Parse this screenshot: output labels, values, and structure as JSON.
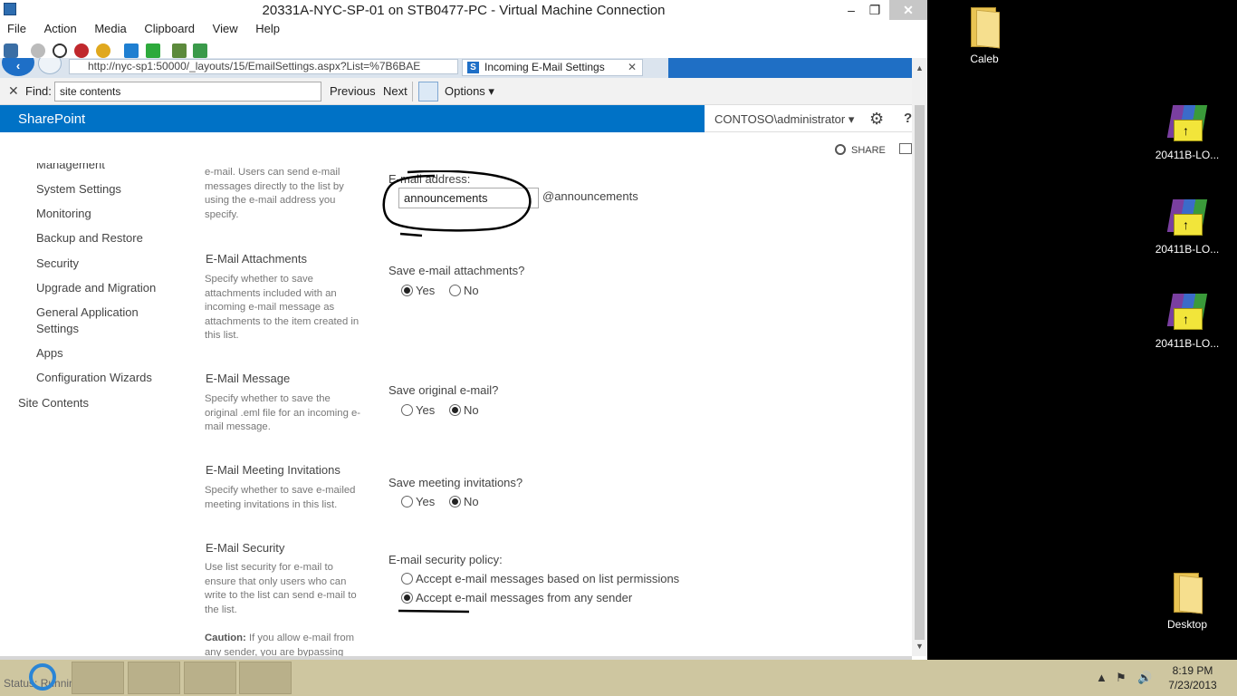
{
  "vm": {
    "title": "20331A-NYC-SP-01 on STB0477-PC - Virtual Machine Connection",
    "minimize": "–",
    "maximize": "❐",
    "close": "✕",
    "menu": [
      "File",
      "Action",
      "Media",
      "Clipboard",
      "View",
      "Help"
    ]
  },
  "browser": {
    "address": "http://nyc-sp1:50000/_layouts/15/EmailSettings.aspx?List=%7B6BAE",
    "tab_title": "Incoming E-Mail Settings",
    "tab_close": "✕"
  },
  "findbar": {
    "close": "✕",
    "label": "Find:",
    "value": "site contents",
    "previous": "Previous",
    "next": "Next",
    "options": "Options ▾"
  },
  "suitebar": {
    "brand": "SharePoint",
    "user": "CONTOSO\\administrator ▾",
    "gear": "⚙",
    "help": "?"
  },
  "sharebar": {
    "share": "SHARE"
  },
  "nav": {
    "items": [
      "Management",
      "System Settings",
      "Monitoring",
      "Backup and Restore",
      "Security",
      "Upgrade and Migration",
      "General Application",
      "Settings",
      "Apps",
      "Configuration Wizards"
    ],
    "site_contents": "Site Contents"
  },
  "sections": {
    "address_desc": "e-mail. Users can send e-mail messages directly to the list by using the e-mail address you specify.",
    "email_label": "E-mail address:",
    "email_value": "announcements",
    "email_suffix": "@announcements",
    "attachments": {
      "title": "E-Mail Attachments",
      "desc": "Specify whether to save attachments included with an incoming e-mail message as attachments to the item created in this list.",
      "question": "Save e-mail attachments?",
      "yes": "Yes",
      "no": "No",
      "selected": "Yes"
    },
    "message": {
      "title": "E-Mail Message",
      "desc": "Specify whether to save the original .eml file for an incoming e-mail message.",
      "question": "Save original e-mail?",
      "yes": "Yes",
      "no": "No",
      "selected": "No"
    },
    "meetings": {
      "title": "E-Mail Meeting Invitations",
      "desc": "Specify whether to save e-mailed meeting invitations in this list.",
      "question": "Save meeting invitations?",
      "yes": "Yes",
      "no": "No",
      "selected": "No"
    },
    "security": {
      "title": "E-Mail Security",
      "desc": "Use list security for e-mail to ensure that only users who can write to the list can send e-mail to the list.",
      "caution_label": "Caution:",
      "caution_text": "If you allow e-mail from any sender, you are bypassing",
      "question": "E-mail security policy:",
      "option1": "Accept e-mail messages based on list permissions",
      "option2": "Accept e-mail messages from any sender",
      "selected": "option2"
    }
  },
  "desktop": {
    "icons": [
      "Caleb",
      "20411B-LO...",
      "20411B-LO...",
      "20411B-LO...",
      "Desktop"
    ]
  },
  "taskbar": {
    "status": "Status: Running",
    "time": "8:19 PM",
    "date": "7/23/2013"
  },
  "colors": {
    "sharepoint_blue": "#0072c6",
    "desktop_bg": "#000000",
    "taskbar_bg": "#cec6a0"
  }
}
